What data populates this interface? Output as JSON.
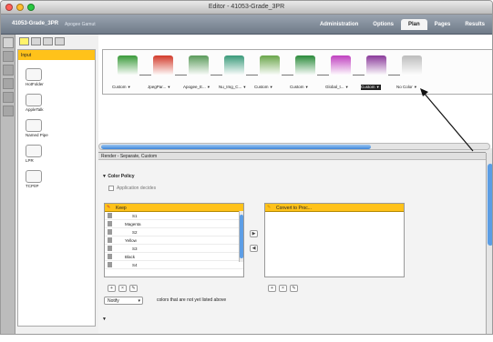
{
  "window": {
    "title": "Editor - 41053-Grade_3PR"
  },
  "toolbar": {
    "job_name": "41053-Grade_3PR",
    "breadcrumb": "Apogee Gamut",
    "tabs": [
      "Administration",
      "Options",
      "Plan",
      "Pages",
      "Results"
    ],
    "active_tab": "Plan"
  },
  "left_panel": {
    "header": "Input",
    "items": [
      "HotFolder",
      "AppleTalk",
      "Named Pipe",
      "LPR",
      "TCP/IP"
    ]
  },
  "plan": {
    "steps": [
      {
        "label": "Custom",
        "icon": "intake-icon",
        "color": "#3a9a3a"
      },
      {
        "label": "JpegPar...",
        "icon": "tools-icon",
        "color": "#d23a2a"
      },
      {
        "label": "Apogee_E...",
        "icon": "pages-icon",
        "color": "#5a9a5a"
      },
      {
        "label": "Nu_Img_C...",
        "icon": "puzzle-icon",
        "color": "#3a9a7a"
      },
      {
        "label": "Custom",
        "icon": "cylinder-icon",
        "color": "#6aa64a"
      },
      {
        "label": "Custom",
        "icon": "arrow-icon",
        "color": "#2a8a3a"
      },
      {
        "label": "Global_t...",
        "icon": "stack-icon",
        "color": "#c040c0"
      },
      {
        "label": "Custom",
        "icon": "book-icon",
        "color": "#8a3a9a"
      },
      {
        "label": "No Color",
        "icon": "eraser-icon",
        "color": "#bdbdbd"
      }
    ],
    "selected_step": "Custom"
  },
  "panel": {
    "header": "Render - Separate, Custom",
    "section_title": "Color Policy",
    "checkbox_label": "Application decides",
    "keep_list": {
      "header": "Keep",
      "rows": [
        "S1",
        "Magenta",
        "S2",
        "Yellow",
        "S3",
        "Black",
        "S4"
      ]
    },
    "convert_list": {
      "header": "Convert to Proc..."
    },
    "notify": {
      "value": "Notify",
      "trailing_text": "colors that are not yet listed above"
    }
  }
}
